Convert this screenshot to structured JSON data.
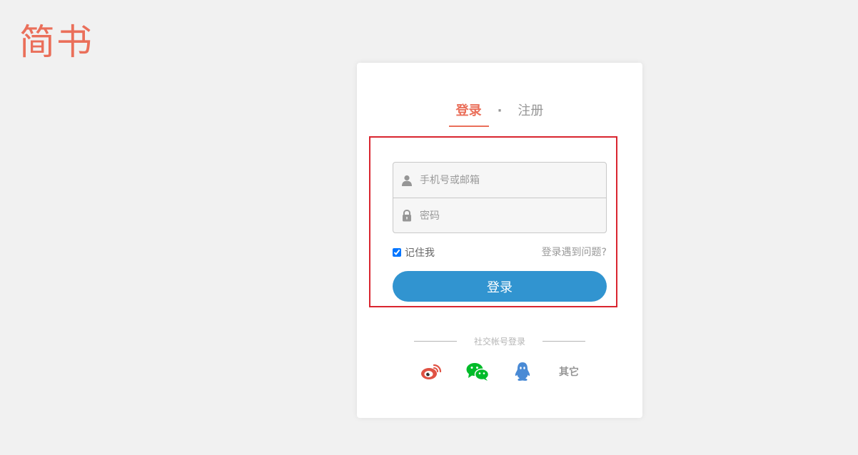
{
  "logo": {
    "text": "简书",
    "color": "#ea6f5a"
  },
  "tabs": {
    "login": "登录",
    "separator": "·",
    "register": "注册"
  },
  "form": {
    "account_placeholder": "手机号或邮箱",
    "password_placeholder": "密码",
    "remember_label": "记住我",
    "remember_checked": true,
    "trouble_link": "登录遇到问题?",
    "submit_label": "登录"
  },
  "social": {
    "title": "社交帐号登录",
    "icons": [
      "weibo-icon",
      "wechat-icon",
      "qq-icon"
    ],
    "other": "其它"
  },
  "colors": {
    "accent": "#ea6f5a",
    "button": "#3194d0",
    "highlight": "#d9252f",
    "weibo": "#e05244",
    "wechat": "#00bb29",
    "qq": "#498ad5"
  }
}
